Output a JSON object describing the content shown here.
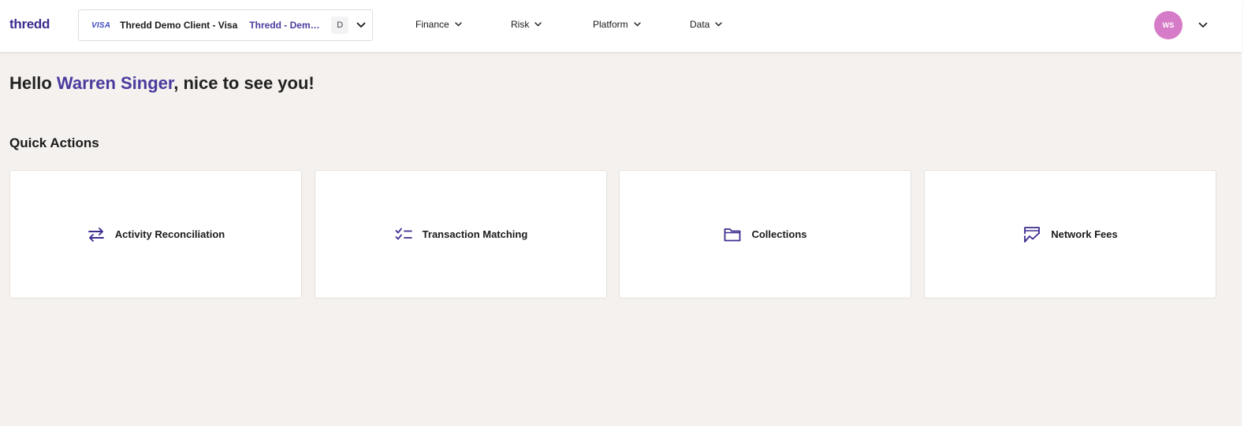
{
  "header": {
    "logo_text": "thredd",
    "client_selector": {
      "network": "VISA",
      "client": "Thredd Demo Client - Visa",
      "program": "Thredd - Demo Program",
      "environment_badge": "D",
      "chevron_icon": "chevron-down-icon"
    },
    "nav": [
      {
        "label": "Finance",
        "icon": "chevron-down-icon"
      },
      {
        "label": "Risk",
        "icon": "chevron-down-icon"
      },
      {
        "label": "Platform",
        "icon": "chevron-down-icon"
      },
      {
        "label": "Data",
        "icon": "chevron-down-icon"
      }
    ],
    "user": {
      "initials": "WS",
      "avatar_color": "#d67bc8",
      "menu_icon": "chevron-down-icon"
    }
  },
  "greeting": {
    "prefix": "Hello ",
    "name": "Warren Singer",
    "suffix": ", nice to see you!"
  },
  "quick_actions": {
    "title": "Quick Actions",
    "items": [
      {
        "label": "Activity Reconciliation",
        "icon": "swap-arrows-icon"
      },
      {
        "label": "Transaction Matching",
        "icon": "checklist-icon"
      },
      {
        "label": "Collections",
        "icon": "folder-icon"
      },
      {
        "label": "Network Fees",
        "icon": "fees-chart-icon"
      }
    ]
  },
  "colors": {
    "brand": "#3d2d8f",
    "accent": "#4b3a9e",
    "page_background": "#f4f1ee",
    "card_background": "#ffffff"
  }
}
